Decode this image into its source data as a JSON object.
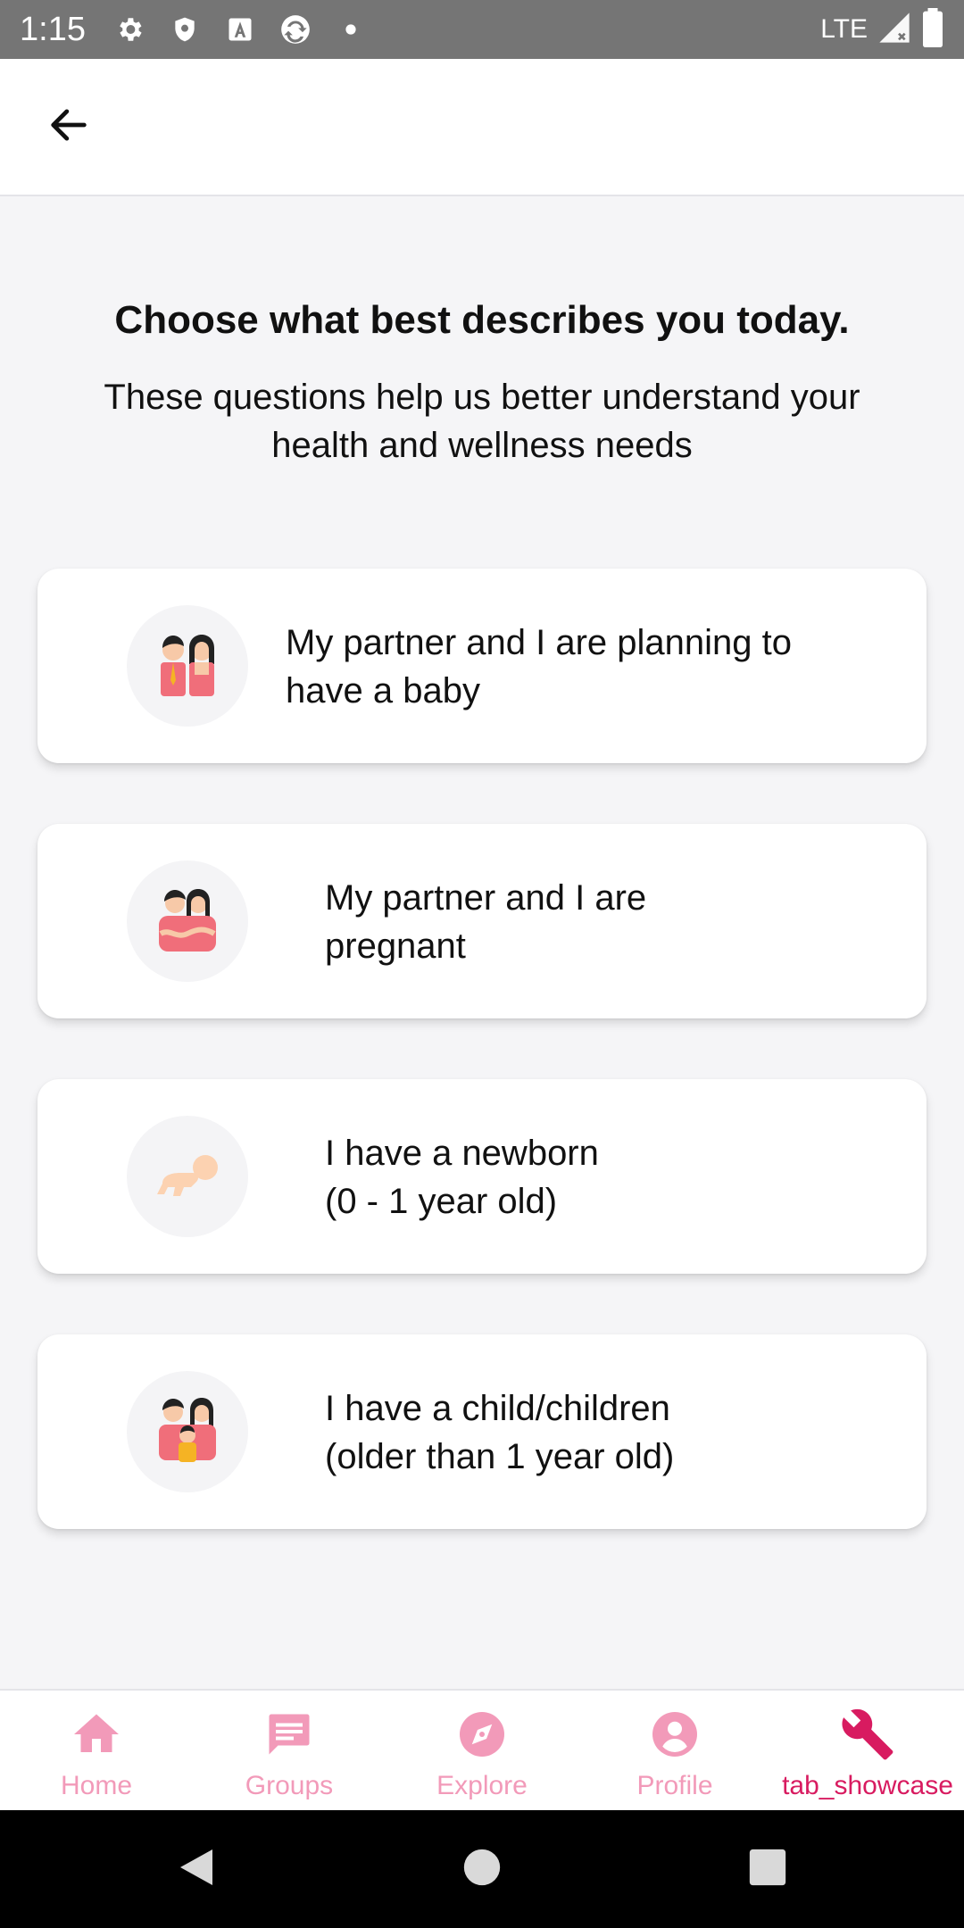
{
  "status_bar": {
    "time": "1:15",
    "network": "LTE",
    "icons": [
      "gear-icon",
      "shield-icon",
      "a-badge-icon",
      "sync-icon",
      "dot-icon",
      "signal-icon",
      "battery-icon"
    ]
  },
  "app_bar": {
    "back_icon": "arrow-left-icon"
  },
  "header": {
    "title": "Choose what best describes you today.",
    "subtitle": "These questions help us better understand your health and wellness needs"
  },
  "options": [
    {
      "label": "My partner and I are planning to\nhave a baby",
      "icon": "couple-icon"
    },
    {
      "label": "My partner and I are\npregnant",
      "icon": "pregnant-couple-icon"
    },
    {
      "label": "I have a newborn\n(0 - 1 year old)",
      "icon": "crawling-baby-icon"
    },
    {
      "label": "I have a child/children\n(older than 1 year old)",
      "icon": "family-icon"
    }
  ],
  "bottom_nav": {
    "items": [
      {
        "label": "Home",
        "icon": "home-icon",
        "active": false
      },
      {
        "label": "Groups",
        "icon": "chat-icon",
        "active": false
      },
      {
        "label": "Explore",
        "icon": "compass-icon",
        "active": false
      },
      {
        "label": "Profile",
        "icon": "person-icon",
        "active": false
      },
      {
        "label": "tab_showcase",
        "icon": "wrench-icon",
        "active": true
      }
    ]
  },
  "colors": {
    "accent": "#d81b60",
    "inactive_nav": "#f29ab9",
    "background": "#f5f5f7",
    "card": "#ffffff"
  }
}
